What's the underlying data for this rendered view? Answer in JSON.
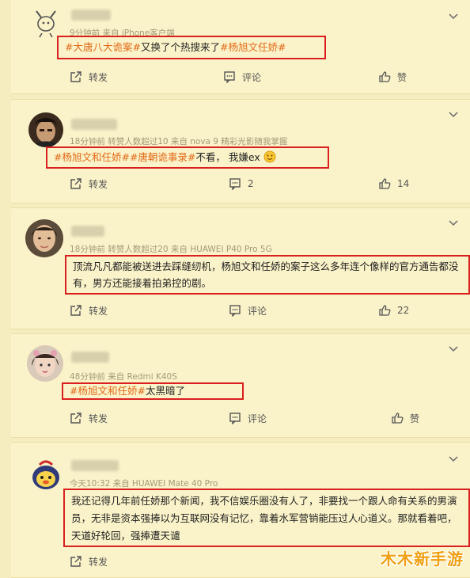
{
  "posts": [
    {
      "meta": "9分钟前  来自 iPhone客户端",
      "content_parts": [
        {
          "tag": "#大唐八大诡案#"
        },
        {
          "text": "又换了个热搜来了"
        },
        {
          "tag": "#杨旭文任娇#"
        }
      ],
      "repost_label": "转发",
      "comment_label": "评论",
      "like_label": "赞"
    },
    {
      "meta": "18分钟前  转赞人数超过10  来自 nova 9 精彩光影随我掌握",
      "content_parts": [
        {
          "tag": "#杨旭文和任娇##唐朝诡事录#"
        },
        {
          "text": "不看， 我嫌ex"
        }
      ],
      "repost_label": "转发",
      "comment_label": "2",
      "like_label": "14"
    },
    {
      "meta": "18分钟前  转赞人数超过20  来自 HUAWEI P40 Pro 5G",
      "content_parts": [
        {
          "text": "顶流凡凡都能被送进去踩缝纫机，杨旭文和任娇的案子这么多年连个像样的官方通告都没有，男方还能接着拍弟控的剧。"
        }
      ],
      "repost_label": "转发",
      "comment_label": "评论",
      "like_label": "22"
    },
    {
      "meta": "48分钟前  来自 Redmi K40S",
      "content_parts": [
        {
          "tag": "#杨旭文和任娇#"
        },
        {
          "text": "太黑暗了"
        }
      ],
      "repost_label": "转发",
      "comment_label": "评论",
      "like_label": "赞"
    },
    {
      "meta": "今天10:32  来自 HUAWEI Mate 40 Pro",
      "content_parts": [
        {
          "text": "我还记得几年前任娇那个新闻，我不信娱乐圈没有人了，非要找一个跟人命有关系的男演员，无非是资本强捧以为互联网没有记忆，靠着水军营销能压过人心道义。那就看着吧，天道好轮回，强捧遭天谴"
        }
      ],
      "repost_label": "转发"
    }
  ],
  "watermark": "木木新手游",
  "colors": {
    "background": "#f5edbf",
    "card": "#faf3c9",
    "highlight_border": "#d9201f",
    "hashtag": "#e36a1a",
    "meta_text": "#a29a78",
    "watermark": "#f0a011"
  },
  "icons": [
    "chevron-down-icon",
    "repost-icon",
    "comment-icon",
    "like-icon",
    "emoji-icon"
  ]
}
